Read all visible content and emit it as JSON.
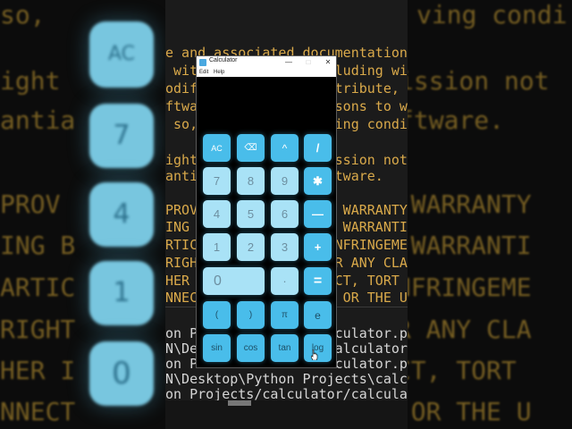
{
  "window": {
    "title": "Calculator",
    "minimize": "—",
    "maximize": "□",
    "close": "✕"
  },
  "menu": {
    "edit": "Edit",
    "help": "Help"
  },
  "display": {
    "value": ""
  },
  "keys": [
    {
      "label": "AC",
      "name": "key-ac"
    },
    {
      "label": "⌫",
      "name": "key-backspace"
    },
    {
      "label": "^",
      "name": "key-power"
    },
    {
      "label": "/",
      "name": "key-divide"
    },
    {
      "label": "7",
      "name": "key-7"
    },
    {
      "label": "8",
      "name": "key-8"
    },
    {
      "label": "9",
      "name": "key-9"
    },
    {
      "label": "✱",
      "name": "key-multiply"
    },
    {
      "label": "4",
      "name": "key-4"
    },
    {
      "label": "5",
      "name": "key-5"
    },
    {
      "label": "6",
      "name": "key-6"
    },
    {
      "label": "—",
      "name": "key-minus"
    },
    {
      "label": "1",
      "name": "key-1"
    },
    {
      "label": "2",
      "name": "key-2"
    },
    {
      "label": "3",
      "name": "key-3"
    },
    {
      "label": "+",
      "name": "key-plus"
    },
    {
      "label": "0",
      "name": "key-0"
    },
    {
      "label": "·",
      "name": "key-decimal"
    },
    {
      "label": "=",
      "name": "key-equals"
    },
    {
      "label": "(",
      "name": "key-open-paren"
    },
    {
      "label": ")",
      "name": "key-close-paren"
    },
    {
      "label": "π",
      "name": "key-pi"
    },
    {
      "label": "e",
      "name": "key-e"
    },
    {
      "label": "sin",
      "name": "key-sin"
    },
    {
      "label": "cos",
      "name": "key-cos"
    },
    {
      "label": "tan",
      "name": "key-tan"
    },
    {
      "label": "log",
      "name": "key-log"
    }
  ],
  "editor_lines": [
    "e and associated documentation file",
    " with               cluding with",
    "odify               stribute,",
    "ftwa                rsons to w",
    " so,                wing condi",
    "",
    "ight                ission not",
    "antia               ftware.",
    "",
    "PROV                T WARRANTY",
    "ING B               E WARRANTI",
    "RTIC                INFRINGEME",
    "RIGHT               OR ANY CLA",
    "HER I               ACT, TORT",
    "NNECT               E OR THE U"
  ],
  "terminal_lines": [
    "on Pr              alculator.py",
    "N\\Des              \\calculator",
    "on Pr              alculator.py",
    "N\\Desktop\\Python Projects\\calculator",
    "on Projects/calculator/calculator.py"
  ],
  "side_left": {
    "keys": [
      "AC",
      "7",
      "4",
      "1",
      "0"
    ],
    "text": [
      "so,",
      "ight",
      "antia",
      "PROV",
      "ING B",
      "ARTIC",
      "RIGHT",
      "HER I",
      "NNECT"
    ]
  },
  "side_right": {
    "text": [
      "ving condi",
      "ission not",
      "ftware.",
      "T WARRANTY",
      "E WARRANTI",
      "INFRINGEME",
      "OR ANY CLA",
      "ACT, TORT",
      "E OR THE U"
    ]
  },
  "colors": {
    "key_light": "#a9e2f6",
    "key_accent": "#49bdea",
    "editor_text": "#d9a94a"
  }
}
